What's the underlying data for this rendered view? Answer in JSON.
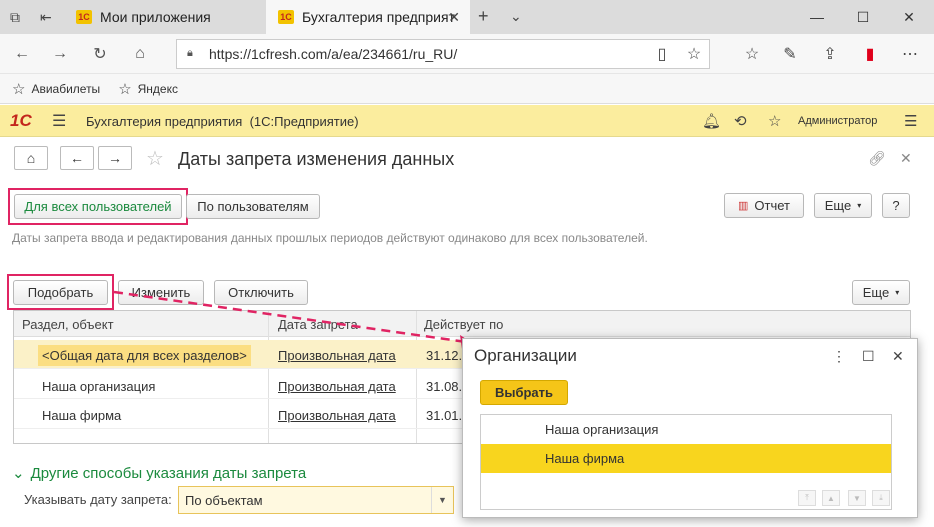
{
  "browser": {
    "tabs": [
      {
        "label": "Мои приложения",
        "icon": "1C"
      },
      {
        "label": "Бухгалтерия предприят",
        "icon": "1C"
      }
    ],
    "url": "https://1cfresh.com/a/ea/234661/ru_RU/",
    "favorites": [
      "Авиабилеты",
      "Яндекс"
    ]
  },
  "app": {
    "logo": "1С",
    "title": "Бухгалтерия предприятия",
    "mode": "(1С:Предприятие)",
    "user": "Администратор"
  },
  "form": {
    "title": "Даты запрета изменения данных",
    "tabs": [
      "Для всех пользователей",
      "По пользователям"
    ],
    "report_button": "Отчет",
    "more_button": "Еще",
    "help_button": "?",
    "description": "Даты запрета ввода и редактирования данных прошлых периодов действуют одинаково для всех пользователей.",
    "toolbar": {
      "pick": "Подобрать",
      "edit": "Изменить",
      "disable": "Отключить",
      "more": "Еще"
    },
    "table": {
      "columns": [
        "Раздел, объект",
        "Дата запрета",
        "Действует по"
      ],
      "rows": [
        {
          "object": "<Общая дата для всех разделов>",
          "date": "Произвольная дата",
          "until": "31.12."
        },
        {
          "object": "Наша организация",
          "date": "Произвольная дата",
          "until": "31.08."
        },
        {
          "object": "Наша фирма",
          "date": "Произвольная дата",
          "until": "31.01."
        }
      ]
    },
    "other_ways": "Другие способы указания даты запрета",
    "specify_label": "Указывать дату запрета:",
    "specify_value": "По объектам"
  },
  "popup": {
    "title": "Организации",
    "select_button": "Выбрать",
    "items": [
      "Наша организация",
      "Наша фирма"
    ],
    "selected_index": 1
  },
  "colors": {
    "accent_yellow": "#f8d51e",
    "highlight_pink": "#e02463",
    "header_yellow": "#fbed9e",
    "green": "#1b8a3e"
  }
}
